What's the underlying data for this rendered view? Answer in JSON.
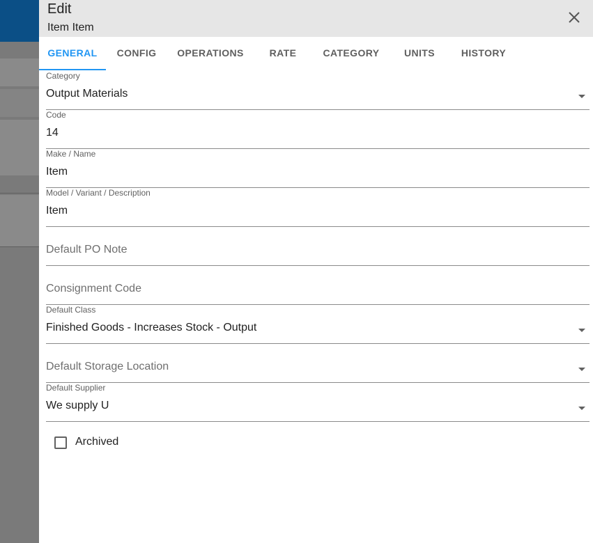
{
  "dialog": {
    "title": "Edit",
    "subtitle": "Item Item",
    "close_icon": "close-icon"
  },
  "tabs": [
    {
      "label": "GENERAL",
      "active": true
    },
    {
      "label": "CONFIG",
      "active": false
    },
    {
      "label": "OPERATIONS",
      "active": false
    },
    {
      "label": "RATE",
      "active": false
    },
    {
      "label": "CATEGORY",
      "active": false
    },
    {
      "label": "UNITS",
      "active": false
    },
    {
      "label": "HISTORY",
      "active": false
    }
  ],
  "fields": {
    "category": {
      "label": "Category",
      "value": "Output Materials"
    },
    "code": {
      "label": "Code",
      "value": "14"
    },
    "make_name": {
      "label": "Make / Name",
      "value": "Item"
    },
    "model": {
      "label": "Model / Variant / Description",
      "value": "Item"
    },
    "po_note": {
      "placeholder": "Default PO Note"
    },
    "consignment": {
      "placeholder": "Consignment Code"
    },
    "default_class": {
      "label": "Default Class",
      "value": "Finished Goods - Increases Stock - Output"
    },
    "storage_location": {
      "placeholder": "Default Storage Location"
    },
    "supplier": {
      "label": "Default Supplier",
      "value": "We supply U"
    }
  },
  "archived": {
    "label": "Archived",
    "checked": false
  },
  "colors": {
    "accent": "#2196f3",
    "header_bg": "#e6e6e6",
    "app_bar": "#0b4f86"
  }
}
